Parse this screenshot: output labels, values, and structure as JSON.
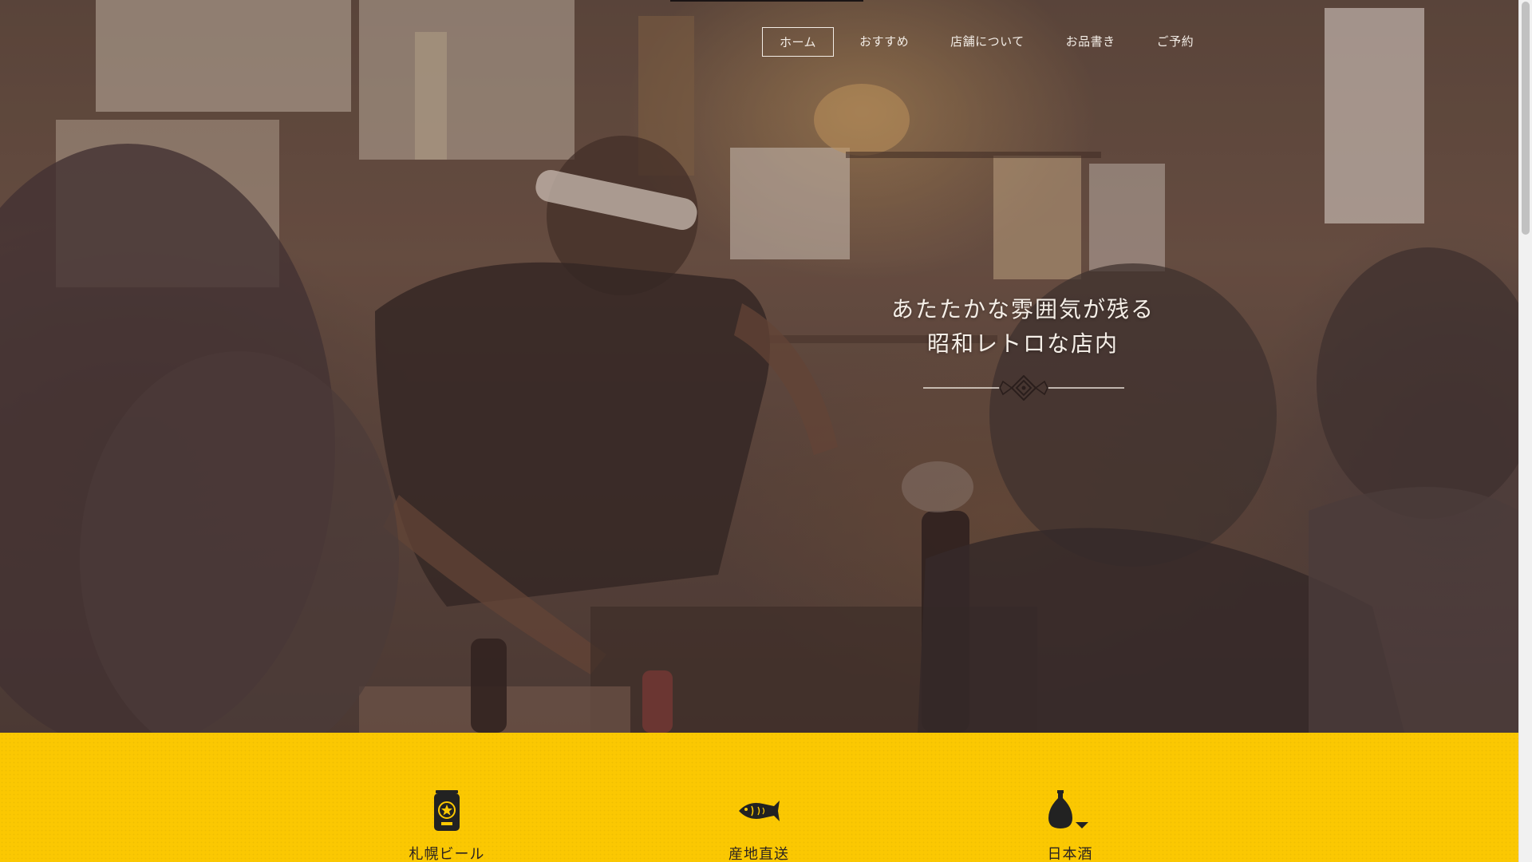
{
  "nav": {
    "items": [
      {
        "label": "ホーム",
        "active": true
      },
      {
        "label": "おすすめ",
        "active": false
      },
      {
        "label": "店舗について",
        "active": false
      },
      {
        "label": "お品書き",
        "active": false
      },
      {
        "label": "ご予約",
        "active": false
      }
    ]
  },
  "hero": {
    "headline_line1": "あたたかな雰囲気が残る",
    "headline_line2": "昭和レトロな店内"
  },
  "features": [
    {
      "label": "札幌ビール",
      "icon": "beer-can-icon"
    },
    {
      "label": "産地直送",
      "icon": "fish-icon"
    },
    {
      "label": "日本酒",
      "icon": "sake-bottle-icon"
    }
  ],
  "colors": {
    "accent_yellow": "#fbc802",
    "nav_text": "#f3ede6",
    "feature_text": "#2b2320"
  }
}
